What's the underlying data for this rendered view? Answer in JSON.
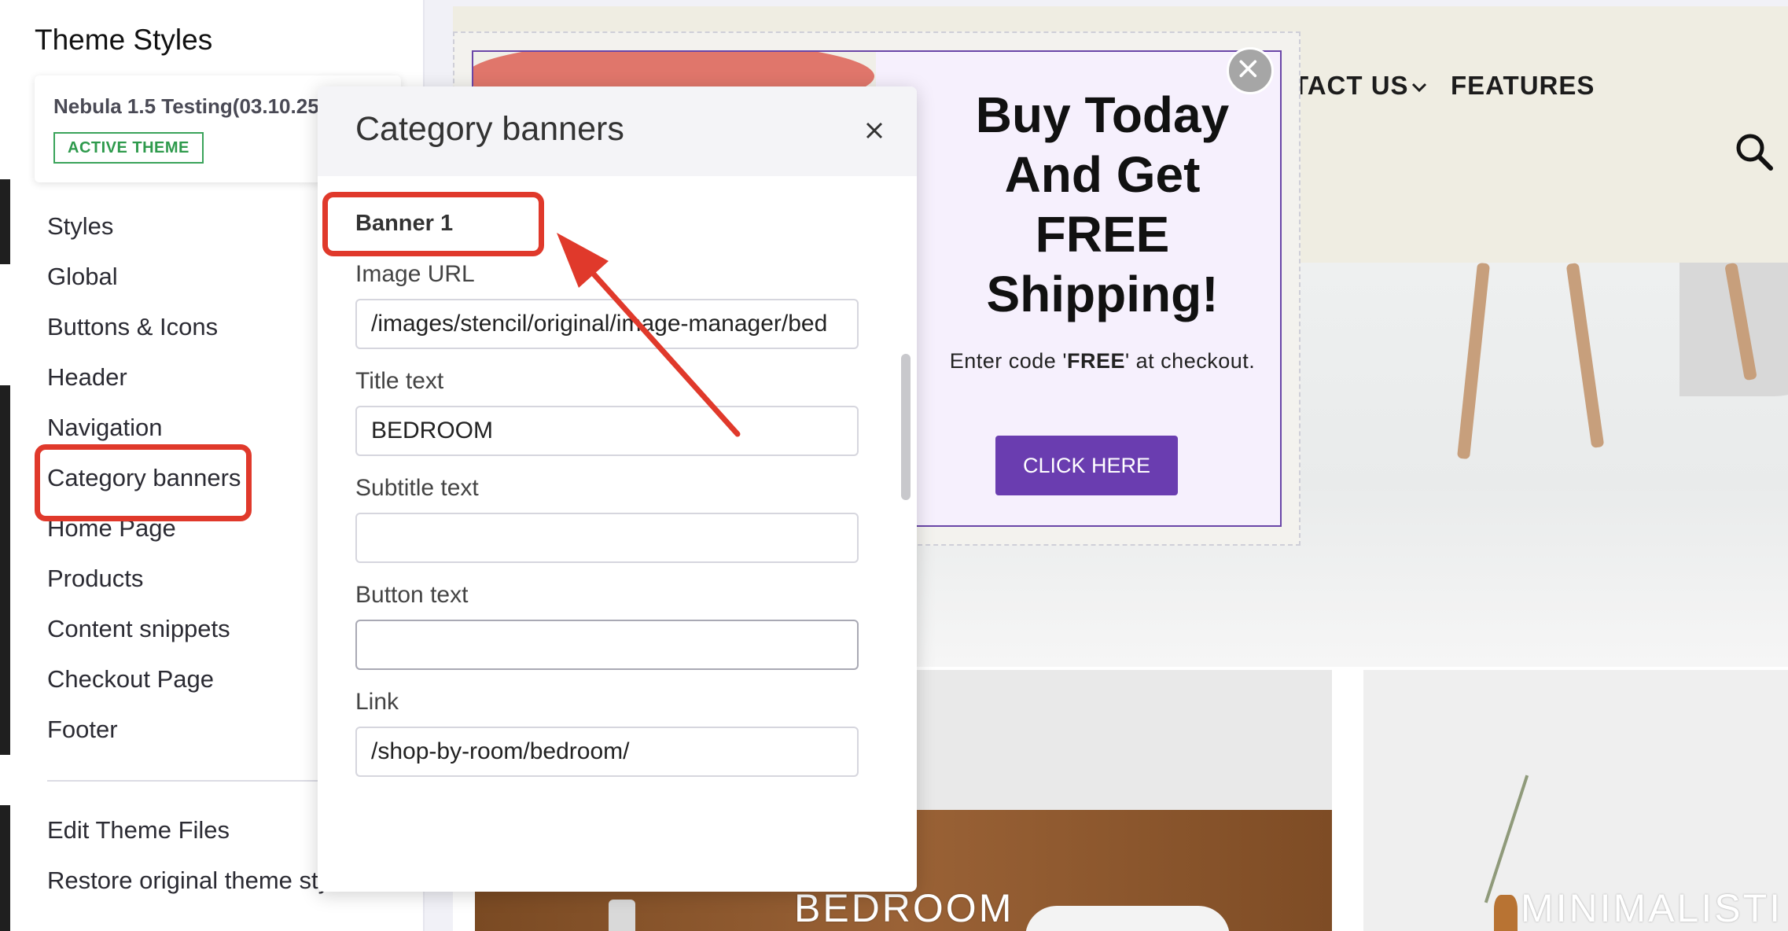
{
  "sidebar": {
    "title": "Theme Styles",
    "theme_name": "Nebula 1.5 Testing(03.10.25)",
    "active_badge": "ACTIVE THEME",
    "items": [
      "Styles",
      "Global",
      "Buttons & Icons",
      "Header",
      "Navigation",
      "Category banners",
      "Home Page",
      "Products",
      "Content snippets",
      "Checkout Page",
      "Footer"
    ],
    "footer_items": [
      "Edit Theme Files",
      "Restore original theme sty"
    ]
  },
  "panel": {
    "title": "Category banners",
    "close_icon": "close-icon",
    "section_title": "Banner 1",
    "fields": {
      "image_url": {
        "label": "Image URL",
        "value": "/images/stencil/original/image-manager/bed"
      },
      "title_text": {
        "label": "Title text",
        "value": "BEDROOM"
      },
      "subtitle_text": {
        "label": "Subtitle text",
        "value": ""
      },
      "button_text": {
        "label": "Button text",
        "value": ""
      },
      "link": {
        "label": "Link",
        "value": "/shop-by-room/bedroom/"
      }
    }
  },
  "site": {
    "nav_contact": "TACT US",
    "nav_features": "FEATURES",
    "icons": {
      "chevron": "chevron-down-icon",
      "search": "search-icon"
    },
    "tiles": [
      "BEDROOM",
      "MINIMALISTI"
    ]
  },
  "promo": {
    "title": "Buy Today And Get FREE Shipping!",
    "subtitle_prefix": "Enter code '",
    "subtitle_code": "FREE",
    "subtitle_suffix": "' at checkout.",
    "button": "CLICK HERE",
    "close_icon": "close-icon"
  },
  "colors": {
    "annotation": "#e0392b",
    "active_badge": "#2e9a4c",
    "promo_button": "#6a3db0",
    "promo_border": "#6a46a8"
  }
}
